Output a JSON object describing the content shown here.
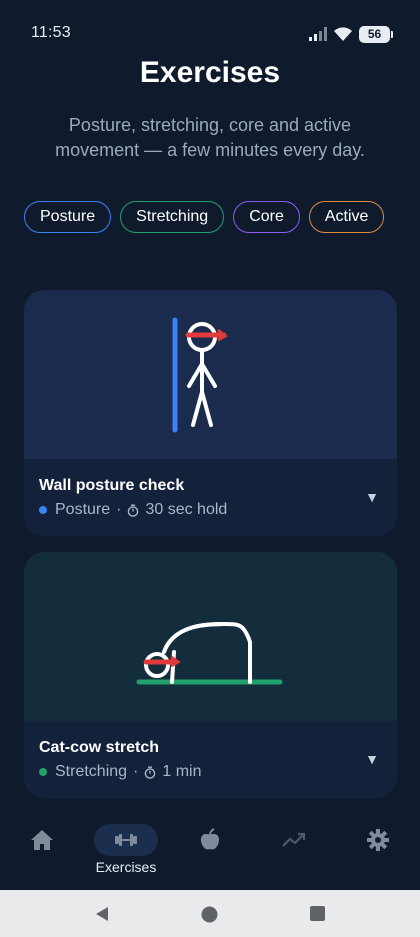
{
  "status_bar": {
    "time": "11:53",
    "battery": "56"
  },
  "header": {
    "title": "Exercises",
    "subtitle": "Posture, stretching, core and active movement — a few minutes every day."
  },
  "filters": [
    {
      "label": "Posture",
      "color": "#3b82f6"
    },
    {
      "label": "Stretching",
      "color": "#22a06b"
    },
    {
      "label": "Core",
      "color": "#8b5cf6"
    },
    {
      "label": "Active",
      "color": "#e08a3c"
    }
  ],
  "exercises": [
    {
      "title": "Wall posture check",
      "category": "Posture",
      "category_color": "#3b82f6",
      "duration": "30 sec hold",
      "bg_color": "#1a2b4d"
    },
    {
      "title": "Cat-cow stretch",
      "category": "Stretching",
      "category_color": "#22a06b",
      "duration": "1 min",
      "bg_color": "#142d3d"
    }
  ],
  "bottom_nav": {
    "items": [
      {
        "icon": "home-icon",
        "label": ""
      },
      {
        "icon": "dumbbell-icon",
        "label": "Exercises",
        "active": true
      },
      {
        "icon": "apple-icon",
        "label": ""
      },
      {
        "icon": "trend-icon",
        "label": ""
      },
      {
        "icon": "gear-icon",
        "label": ""
      }
    ]
  },
  "colors": {
    "background": "#0f1b2d",
    "card": "#13213a",
    "accent": "#3b82f6",
    "headband": "#e03a3a"
  }
}
